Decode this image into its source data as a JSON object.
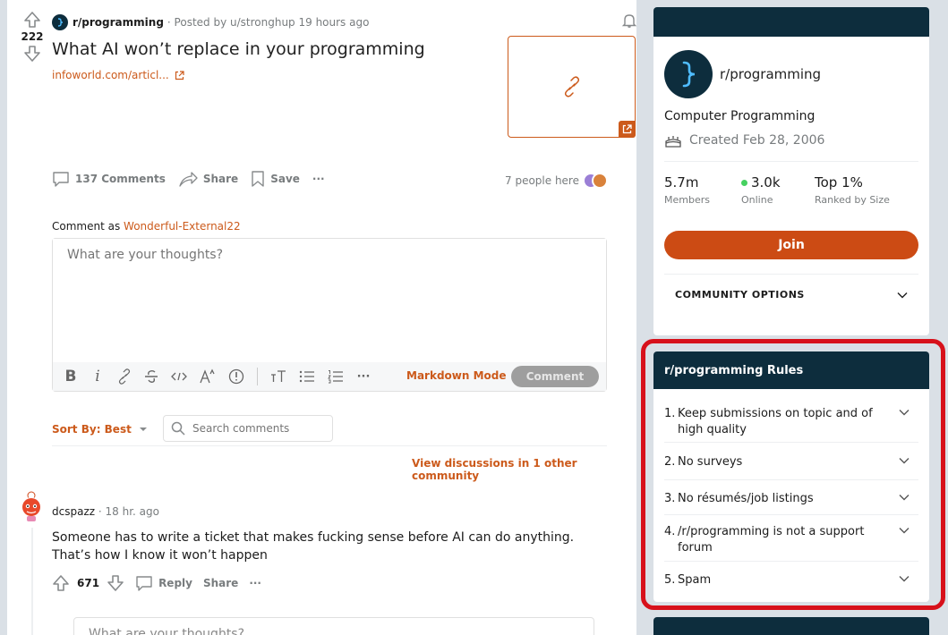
{
  "post": {
    "vote_count": "222",
    "subreddit": "r/programming",
    "posted_by": "· Posted by u/stronghup 19 hours ago",
    "title": "What AI won’t replace in your programming",
    "domain": "infoworld.com/articl...",
    "actions": {
      "comments": "137 Comments",
      "share": "Share",
      "save": "Save",
      "more": "···"
    },
    "people_here": "7 people here"
  },
  "comment_editor": {
    "comment_as_prefix": "Comment as",
    "username": "Wonderful-External22",
    "placeholder": "What are your thoughts?",
    "markdown_mode": "Markdown Mode",
    "comment_button": "Comment",
    "toolbar": {
      "bold": "B",
      "italic": "i",
      "more": "···"
    }
  },
  "comments_bar": {
    "sort_label": "Sort By: Best",
    "search_placeholder": "Search comments",
    "view_discussions": "View discussions in 1 other community"
  },
  "comment": {
    "author": "dcspazz",
    "time": "· 18 hr. ago",
    "text": "Someone has to write a ticket that makes fucking sense before AI can do anything. That’s how I know it won’t happen",
    "votes": "671",
    "reply": "Reply",
    "share": "Share",
    "more": "···",
    "reply_placeholder": "What are your thoughts?"
  },
  "sidebar": {
    "name": "r/programming",
    "description": "Computer Programming",
    "created": "Created Feb 28, 2006",
    "stats": [
      {
        "num": "5.7m",
        "label": "Members"
      },
      {
        "num": "3.0k",
        "label": "Online"
      },
      {
        "num": "Top 1%",
        "label": "Ranked by Size"
      }
    ],
    "join": "Join",
    "community_options": "COMMUNITY OPTIONS"
  },
  "rules": {
    "title": "r/programming Rules",
    "items": [
      {
        "num": "1.",
        "text": "Keep submissions on topic and of high quality"
      },
      {
        "num": "2.",
        "text": "No surveys"
      },
      {
        "num": "3.",
        "text": "No résumés/job listings"
      },
      {
        "num": "4.",
        "text": "/r/programming is not a support forum"
      },
      {
        "num": "5.",
        "text": "Spam"
      }
    ]
  },
  "colors": {
    "accent": "#cc5a1b",
    "join": "#cc4b14",
    "dark": "#0d2d3d",
    "highlight": "#d7111b",
    "online": "#46d160"
  }
}
